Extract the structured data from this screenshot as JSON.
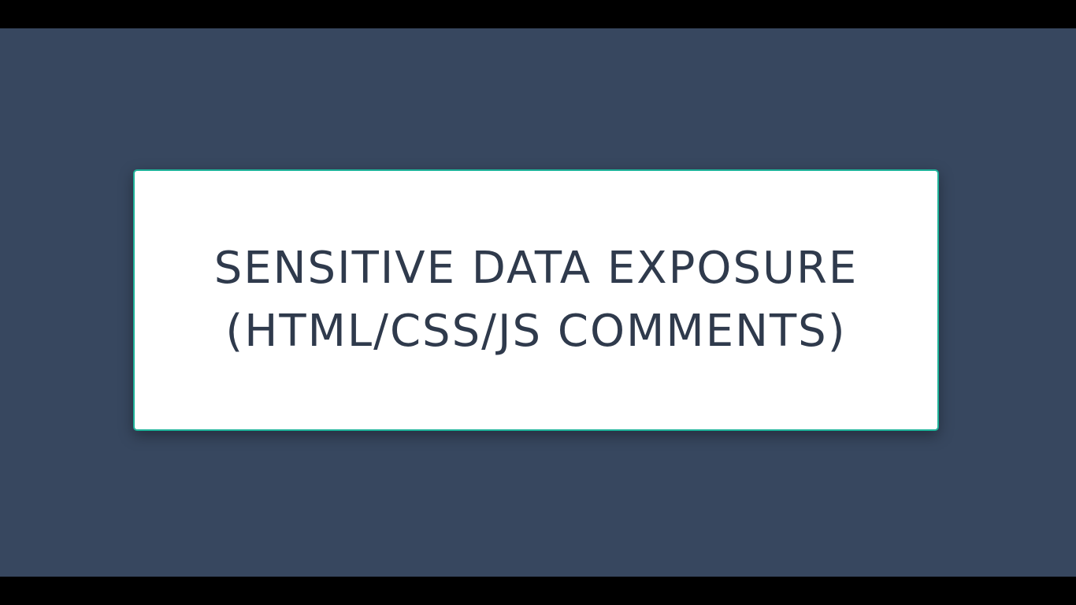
{
  "slide": {
    "title_line_1": "SENSITIVE DATA EXPOSURE",
    "title_line_2": "(HTML/CSS/JS COMMENTS)"
  },
  "colors": {
    "background": "#37475f",
    "card": "#ffffff",
    "card_border": "#1fb39a",
    "text": "#2f3a4c",
    "letterbox": "#000000"
  }
}
